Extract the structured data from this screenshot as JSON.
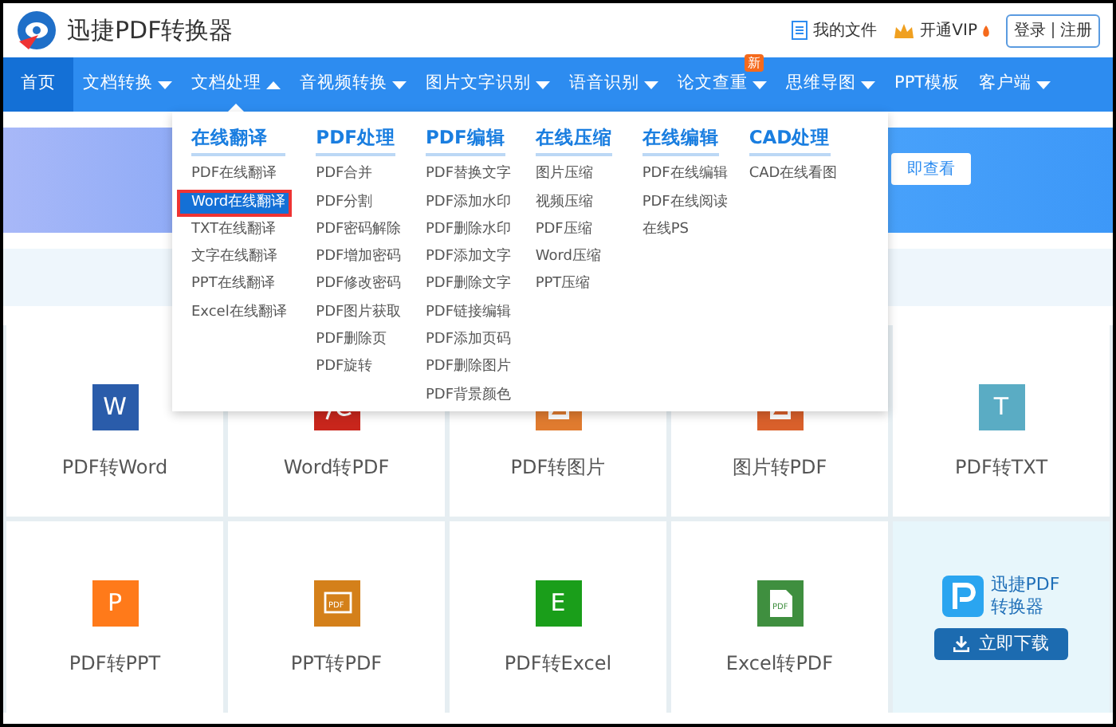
{
  "header": {
    "title": "迅捷PDF转换器",
    "links": [
      {
        "kind": "files",
        "label": "我的文件"
      },
      {
        "kind": "vip",
        "label": "开通VIP"
      }
    ],
    "auth": [
      "登录",
      "注册"
    ]
  },
  "nav": [
    {
      "label": "首页",
      "selected": true
    },
    {
      "label": "文档转换",
      "selected": false,
      "dropdown": true,
      "expanded": false
    },
    {
      "label": "文档处理",
      "selected": false,
      "dropdown": true,
      "expanded": true
    },
    {
      "label": "音视频转换",
      "selected": false,
      "dropdown": true,
      "expanded": false
    },
    {
      "label": "图片文字识别",
      "selected": false,
      "dropdown": true,
      "expanded": false
    },
    {
      "label": "语音识别",
      "selected": false,
      "dropdown": true,
      "expanded": false
    },
    {
      "label": "论文查重",
      "selected": false,
      "dropdown": true,
      "expanded": false,
      "badge": "新"
    },
    {
      "label": "思维导图",
      "selected": false,
      "dropdown": true,
      "expanded": false
    },
    {
      "label": "PPT模板",
      "selected": false
    },
    {
      "label": "客户端",
      "selected": false,
      "dropdown": true,
      "expanded": false
    }
  ],
  "banner": {
    "button": "即查看"
  },
  "menu": [
    {
      "heading": "在线翻译",
      "items": [
        {
          "label": "PDF在线翻译",
          "selected": false
        },
        {
          "label": "Word在线翻译",
          "selected": true
        },
        {
          "label": "TXT在线翻译",
          "selected": false
        },
        {
          "label": "文字在线翻译",
          "selected": false
        },
        {
          "label": "PPT在线翻译",
          "selected": false
        },
        {
          "label": "Excel在线翻译",
          "selected": false
        }
      ]
    },
    {
      "heading": "PDF处理",
      "items": [
        {
          "label": "PDF合并",
          "selected": false
        },
        {
          "label": "PDF分割",
          "selected": false
        },
        {
          "label": "PDF密码解除",
          "selected": false
        },
        {
          "label": "PDF增加密码",
          "selected": false
        },
        {
          "label": "PDF修改密码",
          "selected": false
        },
        {
          "label": "PDF图片获取",
          "selected": false
        },
        {
          "label": "PDF删除页",
          "selected": false
        },
        {
          "label": "PDF旋转",
          "selected": false
        }
      ]
    },
    {
      "heading": "PDF编辑",
      "items": [
        {
          "label": "PDF替换文字",
          "selected": false
        },
        {
          "label": "PDF添加水印",
          "selected": false
        },
        {
          "label": "PDF删除水印",
          "selected": false
        },
        {
          "label": "PDF添加文字",
          "selected": false
        },
        {
          "label": "PDF删除文字",
          "selected": false
        },
        {
          "label": "PDF链接编辑",
          "selected": false
        },
        {
          "label": "PDF添加页码",
          "selected": false
        },
        {
          "label": "PDF删除图片",
          "selected": false
        },
        {
          "label": "PDF背景颜色",
          "selected": false
        }
      ]
    },
    {
      "heading": "在线压缩",
      "items": [
        {
          "label": "图片压缩",
          "selected": false
        },
        {
          "label": "视频压缩",
          "selected": false
        },
        {
          "label": "PDF压缩",
          "selected": false
        },
        {
          "label": "Word压缩",
          "selected": false
        },
        {
          "label": "PPT压缩",
          "selected": false
        }
      ]
    },
    {
      "heading": "在线编辑",
      "items": [
        {
          "label": "PDF在线编辑",
          "selected": false
        },
        {
          "label": "PDF在线阅读",
          "selected": false
        },
        {
          "label": "在线PS",
          "selected": false
        }
      ]
    },
    {
      "heading": "CAD处理",
      "items": [
        {
          "label": "CAD在线看图",
          "selected": false
        }
      ]
    }
  ],
  "tools": [
    {
      "label": "PDF转Word",
      "kind": "letter",
      "icon_text": "W",
      "color": "#2a5caa"
    },
    {
      "label": "Word转PDF",
      "kind": "swirl",
      "color": "#c8261c"
    },
    {
      "label": "PDF转图片",
      "kind": "image",
      "color": "#e07b2f"
    },
    {
      "label": "图片转PDF",
      "kind": "image",
      "color": "#d9602b"
    },
    {
      "label": "PDF转TXT",
      "kind": "letter",
      "icon_text": "T",
      "color": "#5aacc4"
    },
    {
      "label": "PDF转PPT",
      "kind": "letter",
      "icon_text": "P",
      "color": "#ff7a1a"
    },
    {
      "label": "PPT转PDF",
      "kind": "screen",
      "icon_text": "PDF",
      "color": "#d4801a"
    },
    {
      "label": "PDF转Excel",
      "kind": "letter",
      "icon_text": "E",
      "color": "#1a9e1a"
    },
    {
      "label": "Excel转PDF",
      "kind": "doc",
      "icon_text": "PDF",
      "color": "#3f8f3f"
    }
  ],
  "download": {
    "name": [
      "迅捷PDF",
      "转换器"
    ],
    "button": "立即下载"
  }
}
